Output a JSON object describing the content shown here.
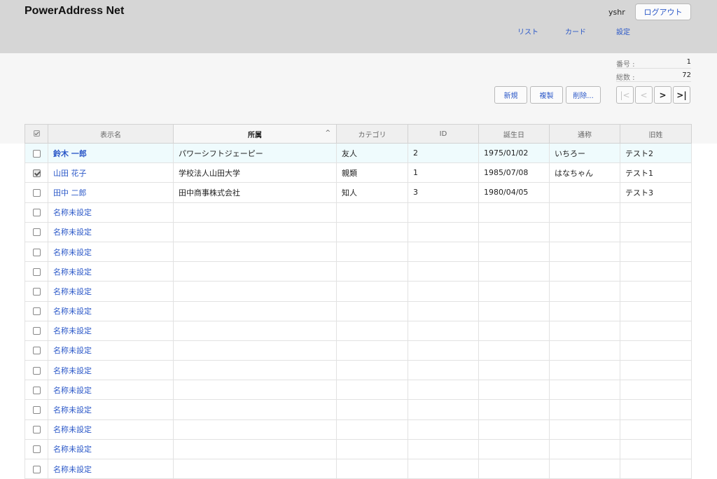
{
  "app": {
    "title": "PowerAddress Net",
    "username": "yshr",
    "logout_label": "ログアウト"
  },
  "nav": {
    "list": "リスト",
    "card": "カード",
    "settings": "設定"
  },
  "info": {
    "number_label": "番号 :",
    "number_value": "1",
    "total_label": "総数 :",
    "total_value": "72"
  },
  "toolbar": {
    "new_label": "新規",
    "duplicate_label": "複製",
    "delete_label": "削除..."
  },
  "pager": {
    "first": "|<",
    "prev": "<",
    "next": ">",
    "last": ">|"
  },
  "table": {
    "headers": {
      "display_name": "表示名",
      "affiliation": "所属",
      "category": "カテゴリ",
      "id": "ID",
      "birthday": "誕生日",
      "nickname": "通称",
      "former_surname": "旧姓"
    },
    "sorted_column": "affiliation",
    "sort_arrow": "^",
    "rows": [
      {
        "name": "鈴木 一郎",
        "affiliation": "パワーシフトジェーピー",
        "category": "友人",
        "id": "2",
        "birthday": "1975/01/02",
        "nickname": "いちろー",
        "former": "テスト2",
        "checked": false,
        "selected": true
      },
      {
        "name": "山田 花子",
        "affiliation": "学校法人山田大学",
        "category": "親類",
        "id": "1",
        "birthday": "1985/07/08",
        "nickname": "はなちゃん",
        "former": "テスト1",
        "checked": true,
        "selected": false
      },
      {
        "name": "田中 二郎",
        "affiliation": "田中商事株式会社",
        "category": "知人",
        "id": "3",
        "birthday": "1980/04/05",
        "nickname": "",
        "former": "テスト3",
        "checked": false,
        "selected": false
      },
      {
        "name": "名称未設定",
        "affiliation": "",
        "category": "",
        "id": "",
        "birthday": "",
        "nickname": "",
        "former": "",
        "checked": false,
        "selected": false
      },
      {
        "name": "名称未設定",
        "affiliation": "",
        "category": "",
        "id": "",
        "birthday": "",
        "nickname": "",
        "former": "",
        "checked": false,
        "selected": false
      },
      {
        "name": "名称未設定",
        "affiliation": "",
        "category": "",
        "id": "",
        "birthday": "",
        "nickname": "",
        "former": "",
        "checked": false,
        "selected": false
      },
      {
        "name": "名称未設定",
        "affiliation": "",
        "category": "",
        "id": "",
        "birthday": "",
        "nickname": "",
        "former": "",
        "checked": false,
        "selected": false
      },
      {
        "name": "名称未設定",
        "affiliation": "",
        "category": "",
        "id": "",
        "birthday": "",
        "nickname": "",
        "former": "",
        "checked": false,
        "selected": false
      },
      {
        "name": "名称未設定",
        "affiliation": "",
        "category": "",
        "id": "",
        "birthday": "",
        "nickname": "",
        "former": "",
        "checked": false,
        "selected": false
      },
      {
        "name": "名称未設定",
        "affiliation": "",
        "category": "",
        "id": "",
        "birthday": "",
        "nickname": "",
        "former": "",
        "checked": false,
        "selected": false
      },
      {
        "name": "名称未設定",
        "affiliation": "",
        "category": "",
        "id": "",
        "birthday": "",
        "nickname": "",
        "former": "",
        "checked": false,
        "selected": false
      },
      {
        "name": "名称未設定",
        "affiliation": "",
        "category": "",
        "id": "",
        "birthday": "",
        "nickname": "",
        "former": "",
        "checked": false,
        "selected": false
      },
      {
        "name": "名称未設定",
        "affiliation": "",
        "category": "",
        "id": "",
        "birthday": "",
        "nickname": "",
        "former": "",
        "checked": false,
        "selected": false
      },
      {
        "name": "名称未設定",
        "affiliation": "",
        "category": "",
        "id": "",
        "birthday": "",
        "nickname": "",
        "former": "",
        "checked": false,
        "selected": false
      },
      {
        "name": "名称未設定",
        "affiliation": "",
        "category": "",
        "id": "",
        "birthday": "",
        "nickname": "",
        "former": "",
        "checked": false,
        "selected": false
      },
      {
        "name": "名称未設定",
        "affiliation": "",
        "category": "",
        "id": "",
        "birthday": "",
        "nickname": "",
        "former": "",
        "checked": false,
        "selected": false
      },
      {
        "name": "名称未設定",
        "affiliation": "",
        "category": "",
        "id": "",
        "birthday": "",
        "nickname": "",
        "former": "",
        "checked": false,
        "selected": false
      }
    ]
  },
  "colors": {
    "header_bg": "#d6d6d6",
    "link": "#2b58c8",
    "selected_row_bg": "#effbfd"
  }
}
